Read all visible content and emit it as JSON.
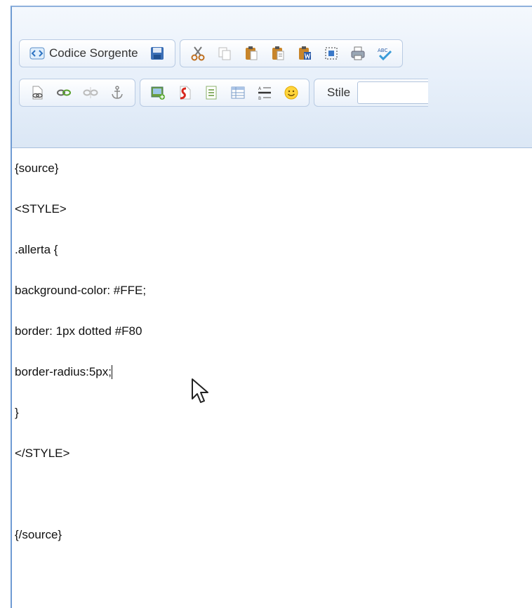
{
  "toolbar": {
    "source_label": "Codice Sorgente",
    "style_label": "Stile",
    "style_value": ""
  },
  "content": {
    "lines": [
      "{source}",
      "<STYLE>",
      ".allerta {",
      "background-color: #FFE;",
      "border: 1px dotted #F80",
      "border-radius:5px;",
      "}",
      "</STYLE>",
      "",
      "{/source}"
    ]
  },
  "icons": {
    "row1": [
      "source-icon",
      "save-icon",
      "cut-icon",
      "copy-icon",
      "paste-icon",
      "paste-text-icon",
      "paste-word-icon",
      "select-all-icon",
      "print-icon",
      "spellcheck-icon"
    ],
    "row2": [
      "link-icon",
      "chain-link-icon",
      "unlink-icon",
      "anchor-icon",
      "image-icon",
      "flash-icon",
      "template-icon",
      "table-icon",
      "horizontal-rule-icon",
      "smiley-icon"
    ]
  },
  "colors": {
    "accent": "#6f9bd3",
    "toolbar_bg": "#e5eef9"
  }
}
